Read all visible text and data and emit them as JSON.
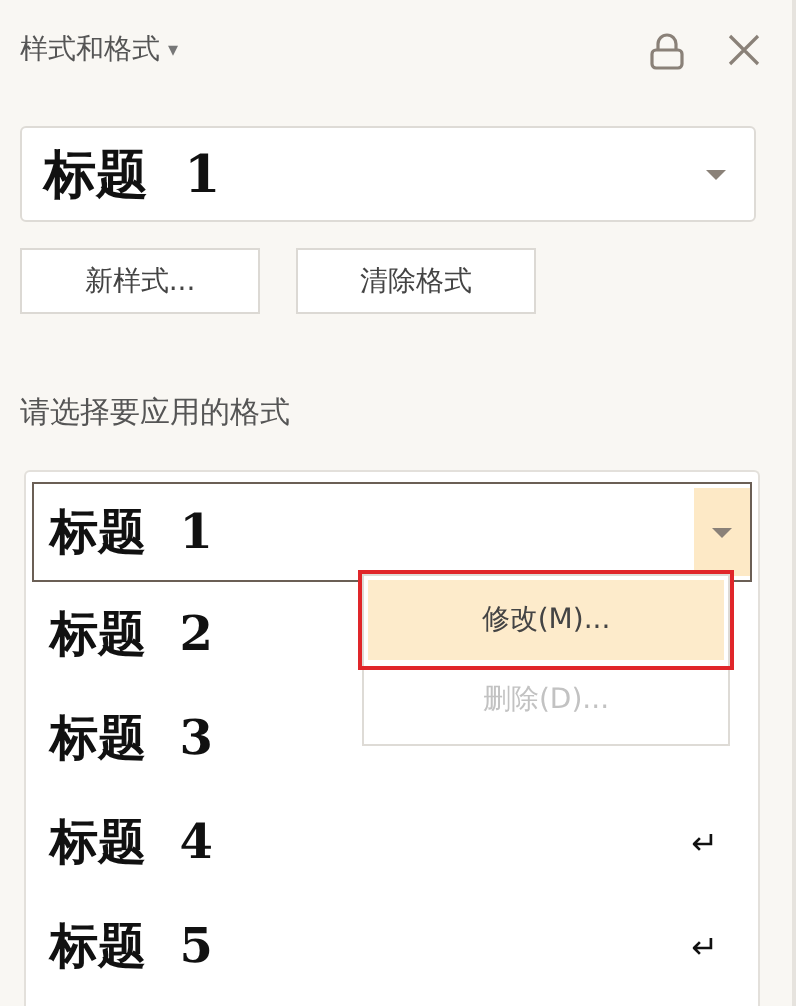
{
  "panel": {
    "title": "样式和格式",
    "title_caret": "▾"
  },
  "current_style": {
    "value": "标题  1"
  },
  "buttons": [
    "新样式...",
    "清除格式"
  ],
  "list_label": "请选择要应用的格式",
  "styles": [
    {
      "label": "标题  1",
      "selected": true
    },
    {
      "label": "标题  2",
      "selected": false
    },
    {
      "label": "标题  3",
      "selected": false
    },
    {
      "label": "标题  4",
      "selected": false,
      "mark": "↵"
    },
    {
      "label": "标题  5",
      "selected": false,
      "mark": "↵"
    }
  ],
  "context_menu": [
    {
      "label": "修改(M)...",
      "highlighted": true,
      "disabled": false
    },
    {
      "label": "删除(D)...",
      "highlighted": false,
      "disabled": true
    }
  ]
}
